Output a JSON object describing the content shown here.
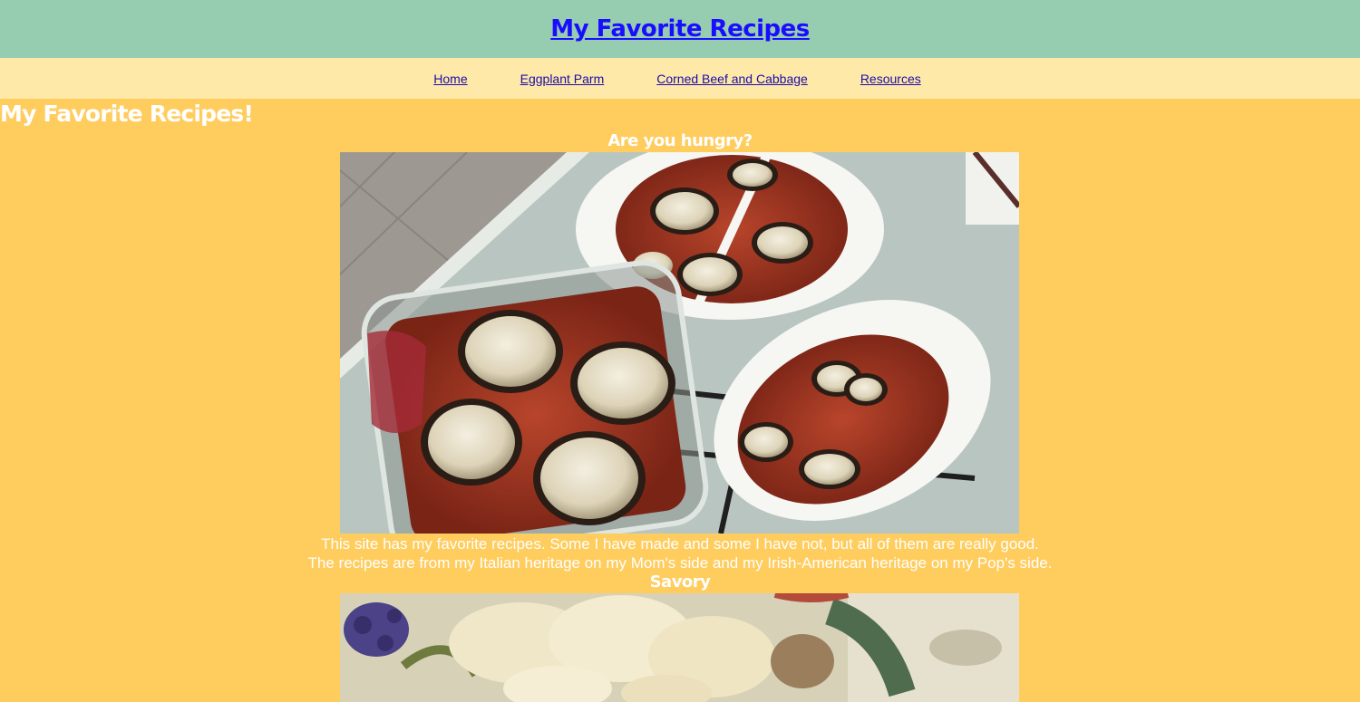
{
  "header": {
    "site_title": "My Favorite Recipes"
  },
  "nav": {
    "items": [
      {
        "label": "Home"
      },
      {
        "label": "Eggplant Parm"
      },
      {
        "label": "Corned Beef and Cabbage"
      },
      {
        "label": "Resources"
      }
    ]
  },
  "main": {
    "page_heading": "My Favorite Recipes!",
    "hungry_heading": "Are you hungry?",
    "intro_line1": "This site has my favorite recipes. Some I have made and some I have not, but all of them are really good.",
    "intro_line2": "The recipes are from my Italian heritage on my Mom's side and my Irish-American heritage on my Pop's side.",
    "savory_heading": "Savory"
  },
  "colors": {
    "banner": "#96cdb1",
    "nav": "#ffe9a8",
    "page": "#ffcc5e",
    "link": "#1a0dab"
  }
}
